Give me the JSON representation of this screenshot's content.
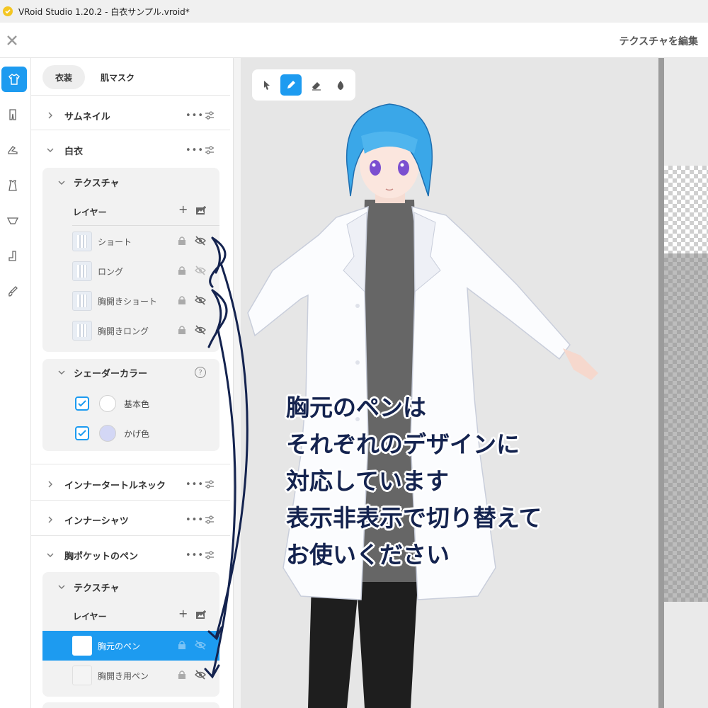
{
  "window": {
    "title": "VRoid Studio 1.20.2 - 白衣サンプル.vroid*"
  },
  "header": {
    "title": "テクスチャを編集"
  },
  "rail": {
    "items": [
      "shirt-icon",
      "pants-icon",
      "shoe-icon",
      "onepiece-icon",
      "underwear-icon",
      "sock-icon",
      "accessory-icon"
    ]
  },
  "tabs": [
    {
      "label": "衣装"
    },
    {
      "label": "肌マスク"
    }
  ],
  "sections": {
    "thumbnail": "サムネイル",
    "coat": "白衣",
    "texture": "テクスチャ",
    "layer_header": "レイヤー",
    "shader": "シェーダーカラー",
    "inner_turtle": "インナータートルネック",
    "inner_shirt": "インナーシャツ",
    "pen": "胸ポケットのペン",
    "pen_texture": "テクスチャ",
    "pen_layer_header": "レイヤー"
  },
  "coat_layers": [
    {
      "name": "ショート",
      "hidden": true
    },
    {
      "name": "ロング",
      "hidden": true
    },
    {
      "name": "胸開きショート",
      "hidden": true
    },
    {
      "name": "胸開きロング",
      "hidden": true
    }
  ],
  "shader_colors": [
    {
      "label": "基本色",
      "checked": true,
      "color": "#ffffff"
    },
    {
      "label": "かげ色",
      "checked": true,
      "color": "#d3d7f5"
    }
  ],
  "pen_layers": [
    {
      "name": "胸元のペン",
      "selected": true
    },
    {
      "name": "胸開き用ペン",
      "selected": false
    }
  ],
  "icons": {
    "more": "•••",
    "help": "?"
  },
  "tools": [
    "select-tool-icon",
    "pen-tool-icon",
    "eraser-tool-icon",
    "fill-tool-icon"
  ],
  "annotation": {
    "lines": [
      "胸元のペンは",
      "それぞれのデザインに",
      "対応しています",
      "表示非表示で切り替えて",
      "お使いください"
    ]
  },
  "colors": {
    "accent": "#1d9bf0",
    "annotation": "#14234f",
    "hair": "#3aa7e8"
  }
}
